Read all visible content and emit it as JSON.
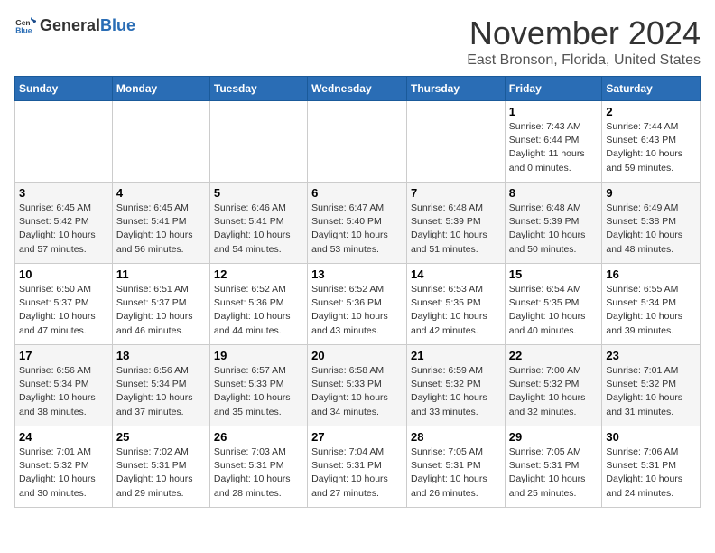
{
  "logo": {
    "general": "General",
    "blue": "Blue"
  },
  "title": "November 2024",
  "location": "East Bronson, Florida, United States",
  "weekdays": [
    "Sunday",
    "Monday",
    "Tuesday",
    "Wednesday",
    "Thursday",
    "Friday",
    "Saturday"
  ],
  "weeks": [
    [
      {
        "day": "",
        "info": ""
      },
      {
        "day": "",
        "info": ""
      },
      {
        "day": "",
        "info": ""
      },
      {
        "day": "",
        "info": ""
      },
      {
        "day": "",
        "info": ""
      },
      {
        "day": "1",
        "info": "Sunrise: 7:43 AM\nSunset: 6:44 PM\nDaylight: 11 hours and 0 minutes."
      },
      {
        "day": "2",
        "info": "Sunrise: 7:44 AM\nSunset: 6:43 PM\nDaylight: 10 hours and 59 minutes."
      }
    ],
    [
      {
        "day": "3",
        "info": "Sunrise: 6:45 AM\nSunset: 5:42 PM\nDaylight: 10 hours and 57 minutes."
      },
      {
        "day": "4",
        "info": "Sunrise: 6:45 AM\nSunset: 5:41 PM\nDaylight: 10 hours and 56 minutes."
      },
      {
        "day": "5",
        "info": "Sunrise: 6:46 AM\nSunset: 5:41 PM\nDaylight: 10 hours and 54 minutes."
      },
      {
        "day": "6",
        "info": "Sunrise: 6:47 AM\nSunset: 5:40 PM\nDaylight: 10 hours and 53 minutes."
      },
      {
        "day": "7",
        "info": "Sunrise: 6:48 AM\nSunset: 5:39 PM\nDaylight: 10 hours and 51 minutes."
      },
      {
        "day": "8",
        "info": "Sunrise: 6:48 AM\nSunset: 5:39 PM\nDaylight: 10 hours and 50 minutes."
      },
      {
        "day": "9",
        "info": "Sunrise: 6:49 AM\nSunset: 5:38 PM\nDaylight: 10 hours and 48 minutes."
      }
    ],
    [
      {
        "day": "10",
        "info": "Sunrise: 6:50 AM\nSunset: 5:37 PM\nDaylight: 10 hours and 47 minutes."
      },
      {
        "day": "11",
        "info": "Sunrise: 6:51 AM\nSunset: 5:37 PM\nDaylight: 10 hours and 46 minutes."
      },
      {
        "day": "12",
        "info": "Sunrise: 6:52 AM\nSunset: 5:36 PM\nDaylight: 10 hours and 44 minutes."
      },
      {
        "day": "13",
        "info": "Sunrise: 6:52 AM\nSunset: 5:36 PM\nDaylight: 10 hours and 43 minutes."
      },
      {
        "day": "14",
        "info": "Sunrise: 6:53 AM\nSunset: 5:35 PM\nDaylight: 10 hours and 42 minutes."
      },
      {
        "day": "15",
        "info": "Sunrise: 6:54 AM\nSunset: 5:35 PM\nDaylight: 10 hours and 40 minutes."
      },
      {
        "day": "16",
        "info": "Sunrise: 6:55 AM\nSunset: 5:34 PM\nDaylight: 10 hours and 39 minutes."
      }
    ],
    [
      {
        "day": "17",
        "info": "Sunrise: 6:56 AM\nSunset: 5:34 PM\nDaylight: 10 hours and 38 minutes."
      },
      {
        "day": "18",
        "info": "Sunrise: 6:56 AM\nSunset: 5:34 PM\nDaylight: 10 hours and 37 minutes."
      },
      {
        "day": "19",
        "info": "Sunrise: 6:57 AM\nSunset: 5:33 PM\nDaylight: 10 hours and 35 minutes."
      },
      {
        "day": "20",
        "info": "Sunrise: 6:58 AM\nSunset: 5:33 PM\nDaylight: 10 hours and 34 minutes."
      },
      {
        "day": "21",
        "info": "Sunrise: 6:59 AM\nSunset: 5:32 PM\nDaylight: 10 hours and 33 minutes."
      },
      {
        "day": "22",
        "info": "Sunrise: 7:00 AM\nSunset: 5:32 PM\nDaylight: 10 hours and 32 minutes."
      },
      {
        "day": "23",
        "info": "Sunrise: 7:01 AM\nSunset: 5:32 PM\nDaylight: 10 hours and 31 minutes."
      }
    ],
    [
      {
        "day": "24",
        "info": "Sunrise: 7:01 AM\nSunset: 5:32 PM\nDaylight: 10 hours and 30 minutes."
      },
      {
        "day": "25",
        "info": "Sunrise: 7:02 AM\nSunset: 5:31 PM\nDaylight: 10 hours and 29 minutes."
      },
      {
        "day": "26",
        "info": "Sunrise: 7:03 AM\nSunset: 5:31 PM\nDaylight: 10 hours and 28 minutes."
      },
      {
        "day": "27",
        "info": "Sunrise: 7:04 AM\nSunset: 5:31 PM\nDaylight: 10 hours and 27 minutes."
      },
      {
        "day": "28",
        "info": "Sunrise: 7:05 AM\nSunset: 5:31 PM\nDaylight: 10 hours and 26 minutes."
      },
      {
        "day": "29",
        "info": "Sunrise: 7:05 AM\nSunset: 5:31 PM\nDaylight: 10 hours and 25 minutes."
      },
      {
        "day": "30",
        "info": "Sunrise: 7:06 AM\nSunset: 5:31 PM\nDaylight: 10 hours and 24 minutes."
      }
    ]
  ]
}
